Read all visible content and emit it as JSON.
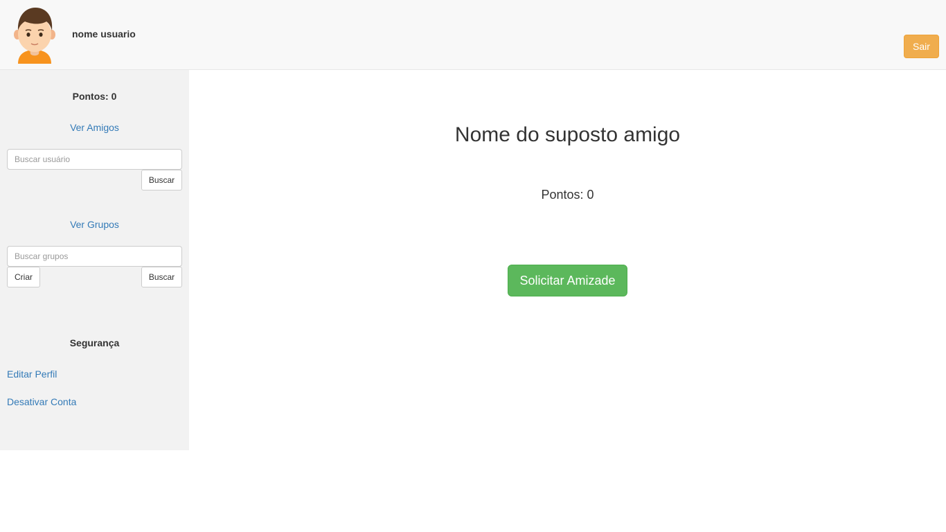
{
  "header": {
    "username": "nome usuario",
    "logout_label": "Sair"
  },
  "sidebar": {
    "points": "Pontos: 0",
    "friends_link": "Ver Amigos",
    "search_users_placeholder": "Buscar usuário",
    "search_users_button": "Buscar",
    "groups_link": "Ver Grupos",
    "search_groups_placeholder": "Buscar grupos",
    "create_group_button": "Criar",
    "search_groups_button": "Buscar",
    "security_heading": "Segurança",
    "edit_profile_link": "Editar Perfil",
    "deactivate_account_link": "Desativar Conta"
  },
  "main": {
    "friend_name": "Nome do suposto amigo",
    "friend_points": "Pontos: 0",
    "request_friendship_button": "Solicitar Amizade"
  },
  "colors": {
    "header_bg": "#f8f8f8",
    "sidebar_bg": "#f2f2f2",
    "link": "#337ab7",
    "warning_button": "#f0ad4e",
    "success_button": "#5cb85c"
  },
  "icons": {
    "avatar": "user-avatar-icon"
  }
}
